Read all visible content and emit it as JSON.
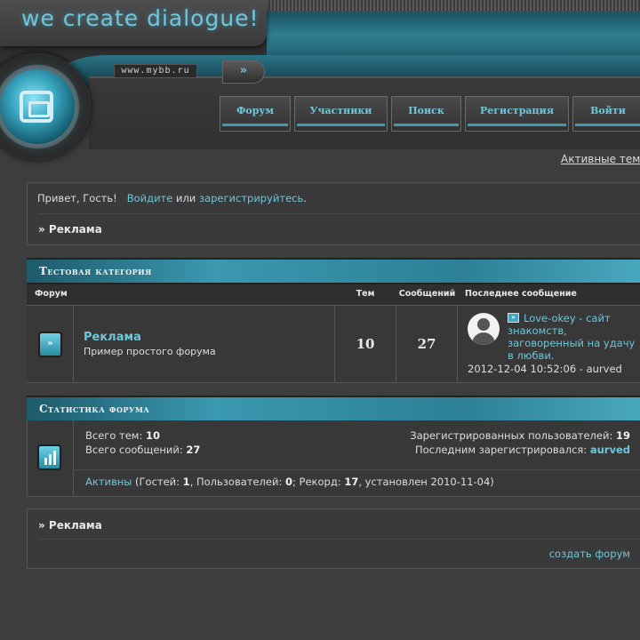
{
  "header": {
    "logo_text": "we create dialogue!",
    "site_url": "www.mybb.ru",
    "go_glyph": "»",
    "orb_icon": "forum-logo-icon"
  },
  "nav": {
    "items": [
      {
        "label": "Форум"
      },
      {
        "label": "Участники"
      },
      {
        "label": "Поиск"
      },
      {
        "label": "Регистрация"
      },
      {
        "label": "Войти"
      }
    ]
  },
  "active_topics_link": "Активные темы",
  "welcome": {
    "greeting": "Привет, Гость!",
    "login_link": "Войдите",
    "or": "или",
    "register_link": "зарегистрируйтесь",
    "dot": ".",
    "breadcrumb": "» Реклама"
  },
  "category": {
    "title": "Тестовая категория",
    "columns": {
      "forum": "Форум",
      "topics": "Тем",
      "posts": "Сообщений",
      "last_post": "Последнее сообщение"
    },
    "forums": [
      {
        "name": "Реклама",
        "description": "Пример простого форума",
        "topics": "10",
        "posts": "27",
        "last_post_icon_glyph": "»",
        "last_post_title": "Love-okey - сайт знакомств, заговоренный на удачу в любви.",
        "last_post_meta": "2012-12-04 10:52:06 - aurved"
      }
    ]
  },
  "stats": {
    "title": "Статистика форума",
    "total_topics_label": "Всего тем:",
    "total_topics": "10",
    "total_posts_label": "Всего сообщений:",
    "total_posts": "27",
    "registered_users_label": "Зарегистрированных пользователей:",
    "registered_users": "19",
    "last_registered_label": "Последним зарегистрировался:",
    "last_registered": "aurved",
    "online_link": "Активны",
    "guests_label": "(Гостей:",
    "guests": "1",
    "users_label": ", Пользователей:",
    "users": "0",
    "record_label": "; Рекорд:",
    "record": "17",
    "record_date_text": ", установлен 2010-11-04)"
  },
  "footer": {
    "breadcrumb": "» Реклама",
    "create_forum_link": "создать форум"
  },
  "colors": {
    "accent": "#6fc6da",
    "background": "#3d3d3d",
    "category_bar": "#2d8096"
  }
}
